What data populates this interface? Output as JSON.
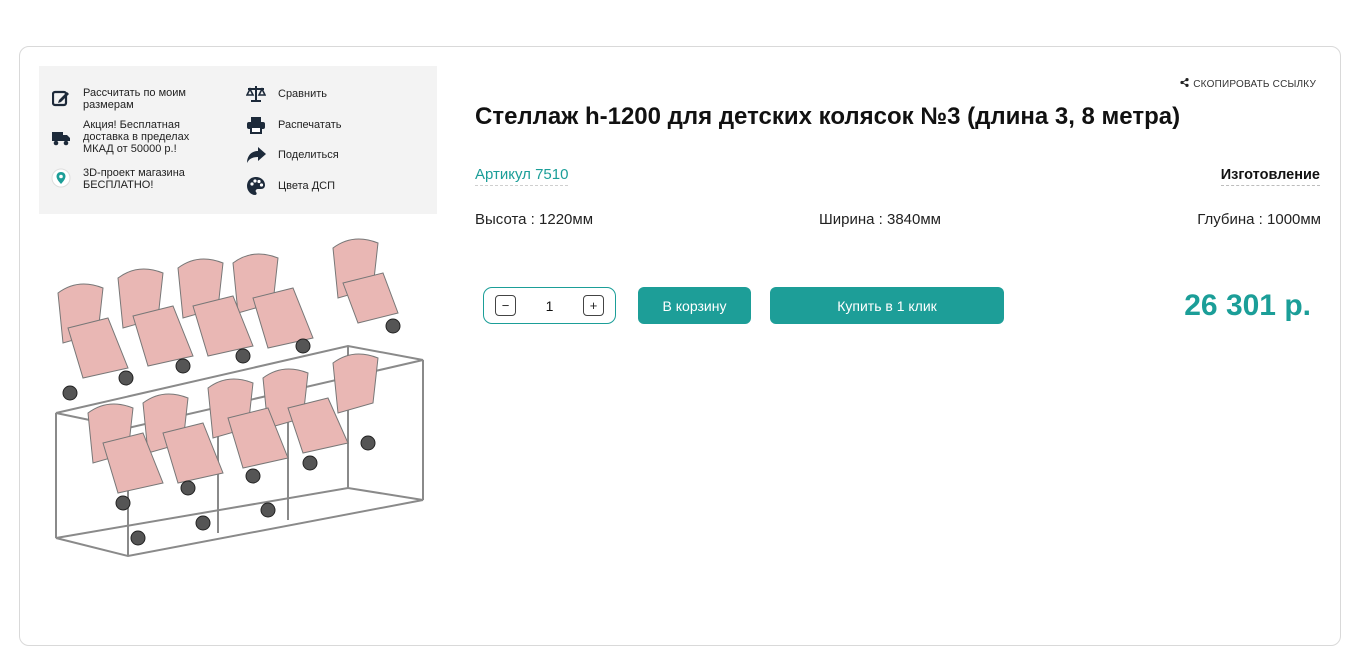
{
  "info_panel": {
    "items_left": [
      {
        "label": "Рассчитать по моим размерам",
        "icon": "edit-icon"
      },
      {
        "label": "Акция! Бесплатная доставка в пределах МКАД от 50000 р.!",
        "icon": "truck-icon"
      },
      {
        "label": "3D-проект магазина БЕСПЛАТНО!",
        "icon": "location-pin-icon"
      }
    ],
    "items_right": [
      {
        "label": "Сравнить",
        "icon": "scales-icon"
      },
      {
        "label": "Распечатать",
        "icon": "printer-icon"
      },
      {
        "label": "Поделиться",
        "icon": "share-arrow-icon"
      },
      {
        "label": "Цвета ДСП",
        "icon": "palette-icon"
      }
    ]
  },
  "product": {
    "copy_link": "СКОПИРОВАТЬ ССЫЛКУ",
    "title": "Стеллаж h-1200 для детских колясок №3 (длина 3, 8 метра)",
    "sku": "Артикул 7510",
    "manufacture": "Изготовление",
    "specs": {
      "height": "Высота : 1220мм",
      "width": "Ширина : 3840мм",
      "depth": "Глубина : 1000мм"
    },
    "quantity": "1",
    "qty_minus": "−",
    "qty_plus": "+",
    "add_to_cart": "В корзину",
    "buy_one_click": "Купить в 1 клик",
    "price": "26 301 р."
  },
  "colors": {
    "accent": "#1d9e98",
    "panel_bg": "#f3f3f3",
    "stroller_pink": "#e9b7b4"
  }
}
